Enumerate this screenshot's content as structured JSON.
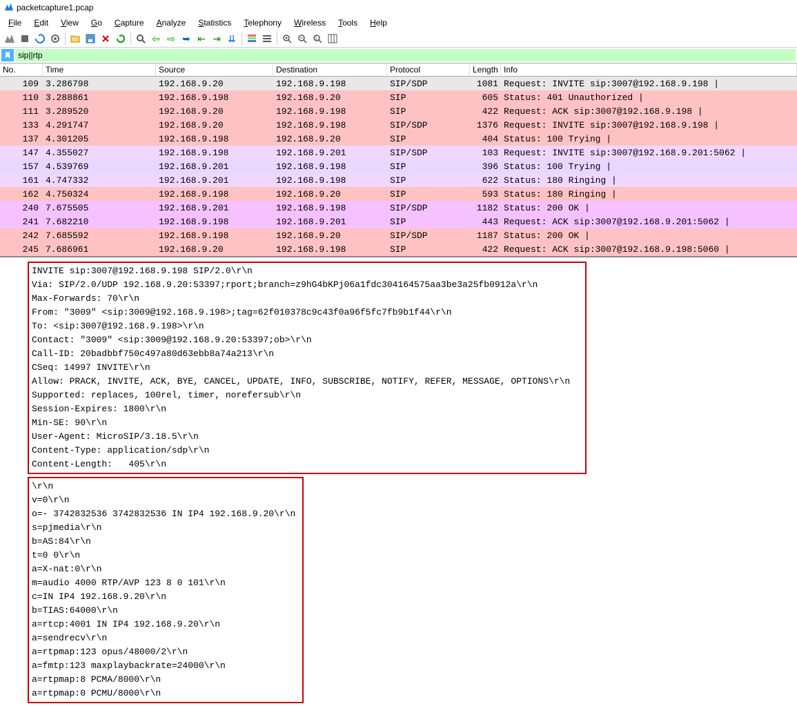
{
  "window": {
    "title": "packetcapture1.pcap"
  },
  "menu": [
    "File",
    "Edit",
    "View",
    "Go",
    "Capture",
    "Analyze",
    "Statistics",
    "Telephony",
    "Wireless",
    "Tools",
    "Help"
  ],
  "filter": {
    "value": "sip||rtp"
  },
  "columns": {
    "no": "No.",
    "time": "Time",
    "src": "Source",
    "dst": "Destination",
    "proto": "Protocol",
    "len": "Length",
    "info": "Info"
  },
  "packets": [
    {
      "no": "109",
      "time": "3.286798",
      "src": "192.168.9.20",
      "dst": "192.168.9.198",
      "proto": "SIP/SDP",
      "len": "1081",
      "info": "Request: INVITE sip:3007@192.168.9.198 |",
      "bg": "#e8e8e8"
    },
    {
      "no": "110",
      "time": "3.288861",
      "src": "192.168.9.198",
      "dst": "192.168.9.20",
      "proto": "SIP",
      "len": "605",
      "info": "Status: 401 Unauthorized |",
      "bg": "#ffc2c2"
    },
    {
      "no": "111",
      "time": "3.289520",
      "src": "192.168.9.20",
      "dst": "192.168.9.198",
      "proto": "SIP",
      "len": "422",
      "info": "Request: ACK sip:3007@192.168.9.198 |",
      "bg": "#ffc2c2"
    },
    {
      "no": "133",
      "time": "4.291747",
      "src": "192.168.9.20",
      "dst": "192.168.9.198",
      "proto": "SIP/SDP",
      "len": "1376",
      "info": "Request: INVITE sip:3007@192.168.9.198 |",
      "bg": "#ffc2c2"
    },
    {
      "no": "137",
      "time": "4.301205",
      "src": "192.168.9.198",
      "dst": "192.168.9.20",
      "proto": "SIP",
      "len": "404",
      "info": "Status: 100 Trying |",
      "bg": "#ffc2c2"
    },
    {
      "no": "147",
      "time": "4.355027",
      "src": "192.168.9.198",
      "dst": "192.168.9.201",
      "proto": "SIP/SDP",
      "len": "103",
      "info": "Request: INVITE sip:3007@192.168.9.201:5062 |",
      "bg": "#f0d7ff"
    },
    {
      "no": "157",
      "time": "4.539769",
      "src": "192.168.9.201",
      "dst": "192.168.9.198",
      "proto": "SIP",
      "len": "396",
      "info": "Status: 100 Trying |",
      "bg": "#e8d7ff"
    },
    {
      "no": "161",
      "time": "4.747332",
      "src": "192.168.9.201",
      "dst": "192.168.9.198",
      "proto": "SIP",
      "len": "622",
      "info": "Status: 180 Ringing |",
      "bg": "#f0d7ff"
    },
    {
      "no": "162",
      "time": "4.750324",
      "src": "192.168.9.198",
      "dst": "192.168.9.20",
      "proto": "SIP",
      "len": "593",
      "info": "Status: 180 Ringing |",
      "bg": "#ffc2c2"
    },
    {
      "no": "240",
      "time": "7.675505",
      "src": "192.168.9.201",
      "dst": "192.168.9.198",
      "proto": "SIP/SDP",
      "len": "1182",
      "info": "Status: 200 OK |",
      "bg": "#f5c2ff"
    },
    {
      "no": "241",
      "time": "7.682210",
      "src": "192.168.9.198",
      "dst": "192.168.9.201",
      "proto": "SIP",
      "len": "443",
      "info": "Request: ACK sip:3007@192.168.9.201:5062 |",
      "bg": "#f5c2ff"
    },
    {
      "no": "242",
      "time": "7.685592",
      "src": "192.168.9.198",
      "dst": "192.168.9.20",
      "proto": "SIP/SDP",
      "len": "1187",
      "info": "Status: 200 OK |",
      "bg": "#ffc2c2"
    },
    {
      "no": "245",
      "time": "7.686961",
      "src": "192.168.9.20",
      "dst": "192.168.9.198",
      "proto": "SIP",
      "len": "422",
      "info": "Request: ACK sip:3007@192.168.9.198:5060 |",
      "bg": "#ffc2c2"
    }
  ],
  "sip_headers": [
    "INVITE sip:3007@192.168.9.198 SIP/2.0\\r\\n",
    "Via: SIP/2.0/UDP 192.168.9.20:53397;rport;branch=z9hG4bKPj06a1fdc304164575aa3be3a25fb0912a\\r\\n",
    "Max-Forwards: 70\\r\\n",
    "From: \"3009\" <sip:3009@192.168.9.198>;tag=62f010378c9c43f0a96f5fc7fb9b1f44\\r\\n",
    "To: <sip:3007@192.168.9.198>\\r\\n",
    "Contact: \"3009\" <sip:3009@192.168.9.20:53397;ob>\\r\\n",
    "Call-ID: 20badbbf750c497a80d63ebb8a74a213\\r\\n",
    "CSeq: 14997 INVITE\\r\\n",
    "Allow: PRACK, INVITE, ACK, BYE, CANCEL, UPDATE, INFO, SUBSCRIBE, NOTIFY, REFER, MESSAGE, OPTIONS\\r\\n",
    "Supported: replaces, 100rel, timer, norefersub\\r\\n",
    "Session-Expires: 1800\\r\\n",
    "Min-SE: 90\\r\\n",
    "User-Agent: MicroSIP/3.18.5\\r\\n",
    "Content-Type: application/sdp\\r\\n",
    "Content-Length:   405\\r\\n"
  ],
  "sdp_body": [
    "\\r\\n",
    "v=0\\r\\n",
    "o=- 3742832536 3742832536 IN IP4 192.168.9.20\\r\\n",
    "s=pjmedia\\r\\n",
    "b=AS:84\\r\\n",
    "t=0 0\\r\\n",
    "a=X-nat:0\\r\\n",
    "m=audio 4000 RTP/AVP 123 8 0 101\\r\\n",
    "c=IN IP4 192.168.9.20\\r\\n",
    "b=TIAS:64000\\r\\n",
    "a=rtcp:4001 IN IP4 192.168.9.20\\r\\n",
    "a=sendrecv\\r\\n",
    "a=rtpmap:123 opus/48000/2\\r\\n",
    "a=fmtp:123 maxplaybackrate=24000\\r\\n",
    "a=rtpmap:8 PCMA/8000\\r\\n",
    "a=rtpmap:0 PCMU/8000\\r\\n"
  ]
}
